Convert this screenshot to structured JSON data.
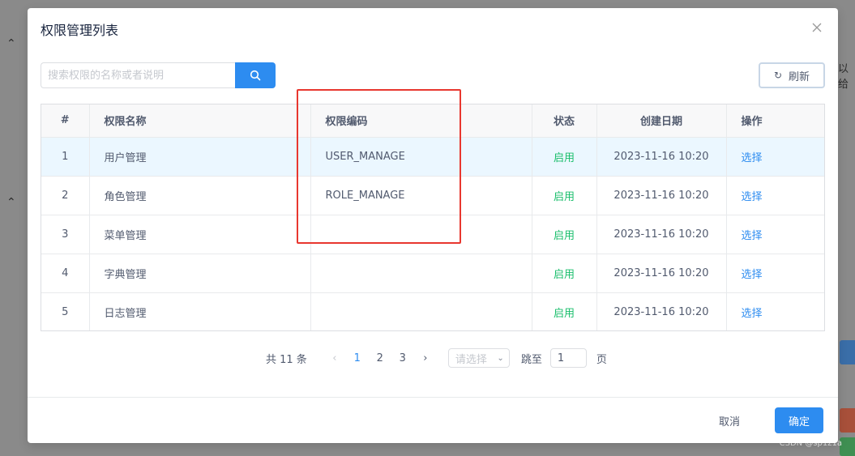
{
  "background": {
    "side_text": "以给",
    "watermark": "CSDN @sp1z1a"
  },
  "modal": {
    "title": "权限管理列表",
    "close_icon": "close-icon"
  },
  "toolbar": {
    "search_placeholder": "搜索权限的名称或者说明",
    "search_value": "",
    "search_icon": "search-icon",
    "refresh_label": "刷新",
    "refresh_icon": "refresh-icon"
  },
  "table": {
    "headers": [
      "#",
      "权限名称",
      "权限编码",
      "状态",
      "创建日期",
      "操作"
    ],
    "rows": [
      {
        "index": "1",
        "name": "用户管理",
        "code": "USER_MANAGE",
        "status": "启用",
        "created": "2023-11-16 10:20",
        "action": "选择"
      },
      {
        "index": "2",
        "name": "角色管理",
        "code": "ROLE_MANAGE",
        "status": "启用",
        "created": "2023-11-16 10:20",
        "action": "选择"
      },
      {
        "index": "3",
        "name": "菜单管理",
        "code": "",
        "status": "启用",
        "created": "2023-11-16 10:20",
        "action": "选择"
      },
      {
        "index": "4",
        "name": "字典管理",
        "code": "",
        "status": "启用",
        "created": "2023-11-16 10:20",
        "action": "选择"
      },
      {
        "index": "5",
        "name": "日志管理",
        "code": "",
        "status": "启用",
        "created": "2023-11-16 10:20",
        "action": "选择"
      }
    ]
  },
  "pagination": {
    "total_text": "共 11 条",
    "pages": [
      "1",
      "2",
      "3"
    ],
    "current_page": "1",
    "size_placeholder": "请选择",
    "jump_label": "跳至",
    "jump_value": "1",
    "page_unit": "页"
  },
  "footer": {
    "cancel_label": "取消",
    "ok_label": "确定"
  },
  "colors": {
    "primary": "#2d8cf0",
    "status_enabled": "#19be6b",
    "highlight_row": "#ebf7ff",
    "annotation": "#e8372f"
  }
}
